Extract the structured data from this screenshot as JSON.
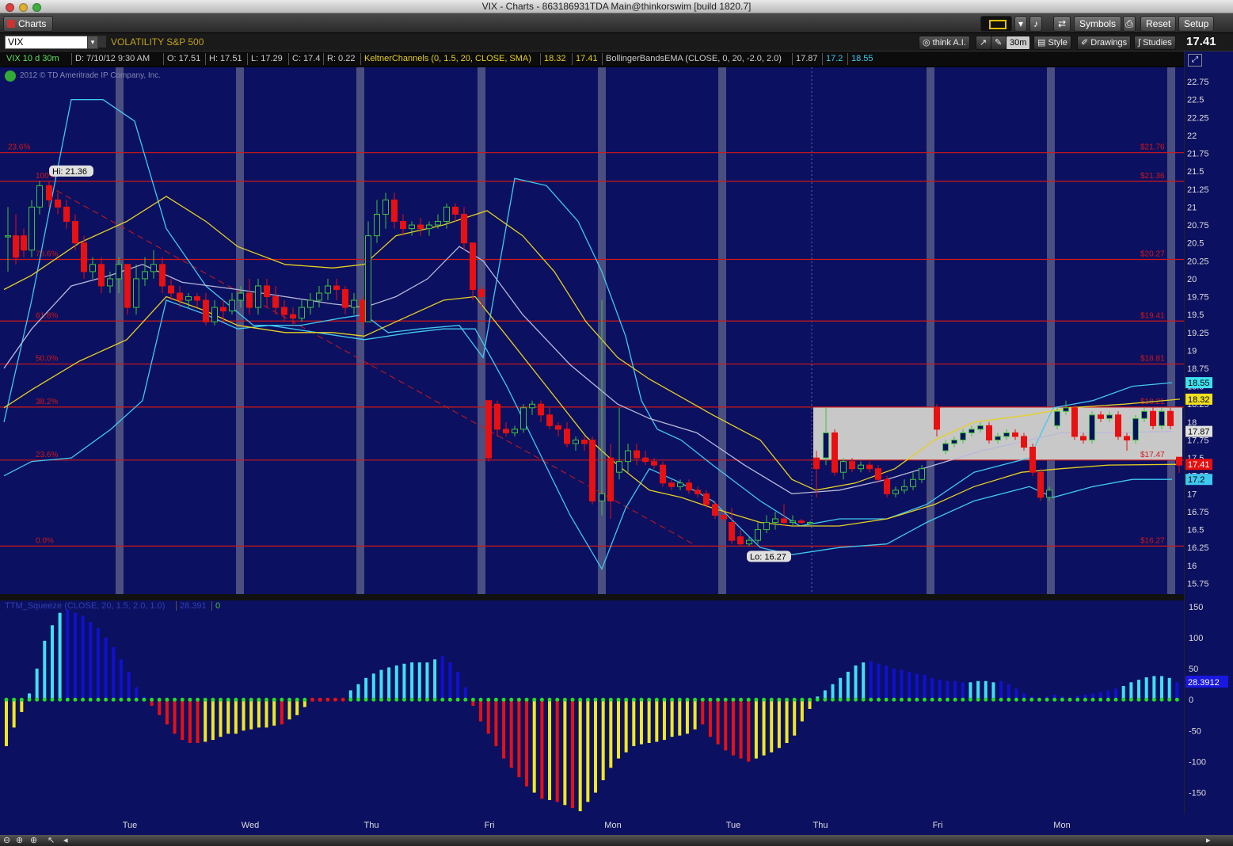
{
  "window": {
    "title": "VIX - Charts - 863186931TDA Main@thinkorswim [build 1820.7]"
  },
  "toolbar": {
    "tab_label": "Charts",
    "symbols_label": "Symbols",
    "reset_label": "Reset",
    "setup_label": "Setup"
  },
  "symbol_bar": {
    "symbol": "VIX",
    "description": "VOLATILITY S&P 500",
    "think_ai": "think A.I.",
    "aggregation": "30m",
    "style": "Style",
    "drawings": "Drawings",
    "studies": "Studies",
    "last_price": "17.41"
  },
  "study_bar": {
    "chart_label": "VIX 10 d 30m",
    "date": "D: 7/10/12 9:30 AM",
    "open": "O: 17.51",
    "high": "H: 17.51",
    "low": "L: 17.29",
    "close": "C: 17.4",
    "range": "R: 0.22",
    "keltner_name": "KeltnerChannels (0, 1.5, 20, CLOSE, SMA)",
    "keltner_v1": "18.32",
    "keltner_v2": "17.41",
    "bollinger_name": "BollingerBandsEMA (CLOSE, 0, 20, -2.0, 2.0)",
    "boll_v1": "17.87",
    "boll_v2": "17.2",
    "boll_v3": "18.55"
  },
  "copyright": "2012 © TD Ameritrade IP Company, Inc.",
  "colors": {
    "background": "#0c1060",
    "up": "#3ec23e",
    "down": "#e81010",
    "keltner": "#e6d020",
    "bollinger": "#40c8f0",
    "mid": "#b8b8d8",
    "fib": "#d01818"
  },
  "chart_data": [
    {
      "type": "candlestick",
      "ylim": [
        15.6,
        22.95
      ],
      "yticks": [
        "22.75",
        "22.5",
        "22.25",
        "22",
        "21.75",
        "21.5",
        "21.25",
        "21",
        "20.75",
        "20.5",
        "20.25",
        "20",
        "19.75",
        "19.5",
        "19.25",
        "19",
        "18.75",
        "18.5",
        "18.25",
        "18",
        "17.75",
        "17.5",
        "17.25",
        "17",
        "16.75",
        "16.5",
        "16.25",
        "16",
        "15.75"
      ],
      "hi_label": "Hi: 21.36",
      "lo_label": "Lo: 16.27",
      "fib_left": [
        {
          "label": "23.6%",
          "value": 21.76
        },
        {
          "label": "100%",
          "value": 21.36
        },
        {
          "label": "78.6%",
          "value": 20.27
        },
        {
          "label": "61.8%",
          "value": 19.41
        },
        {
          "label": "50.0%",
          "value": 18.81
        },
        {
          "label": "38.2%",
          "value": 18.21
        },
        {
          "label": "23.6%",
          "value": 17.47
        },
        {
          "label": "0.0%",
          "value": 16.27
        }
      ],
      "fib_right": [
        "$21.76",
        "$21.36",
        "$20.27",
        "$19.41",
        "$18.81",
        "$18.21",
        "$17.47",
        "$16.27"
      ],
      "price_badges": [
        {
          "value": "18.55"
        },
        {
          "value": "18.32"
        },
        {
          "value": "17.87"
        },
        {
          "value": "17.41"
        },
        {
          "value": "17.2"
        }
      ]
    },
    {
      "type": "bar",
      "study": "TTM_Squeeze (CLOSE, 20, 1.5, 2.0, 1.0)",
      "value_label": "28.391",
      "zero_label": "0",
      "last_badge": "28.3912",
      "ylim": [
        -185,
        160
      ],
      "yticks": [
        "150",
        "100",
        "50",
        "0",
        "-50",
        "-100",
        "-150"
      ]
    }
  ],
  "xaxis": {
    "labels": [
      "Tue",
      "Wed",
      "Thu",
      "Fri",
      "Mon",
      "Tue",
      "Thu",
      "Fri",
      "Mon"
    ]
  }
}
